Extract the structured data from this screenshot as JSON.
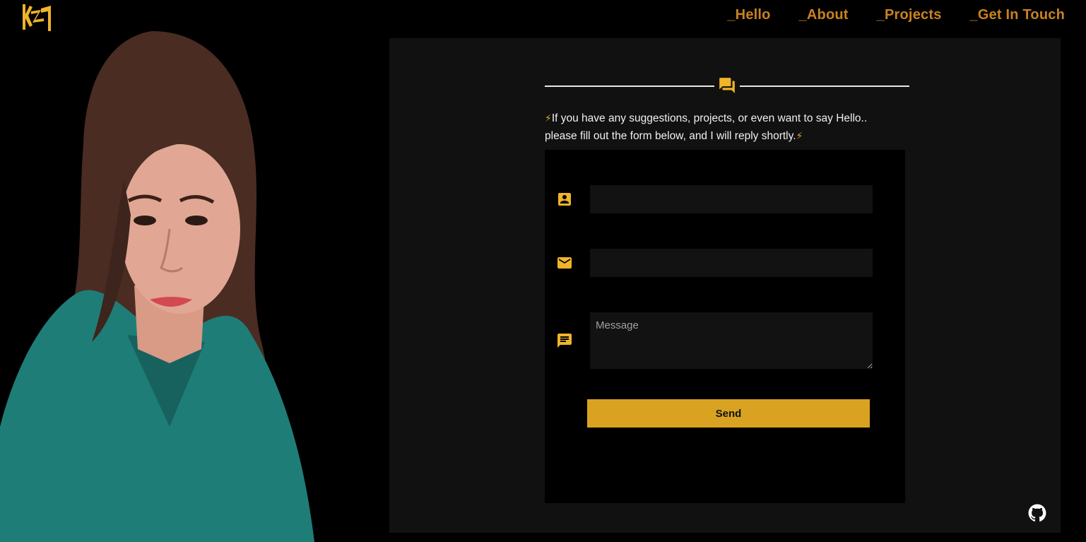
{
  "brand": {
    "logo_icon": "kz-logo-icon",
    "accent": "#f0b428"
  },
  "nav": {
    "items": [
      {
        "label": "_Hello"
      },
      {
        "label": "_About"
      },
      {
        "label": "_Projects"
      },
      {
        "label": "_Get In Touch"
      }
    ],
    "color": "#c9821f"
  },
  "contact": {
    "divider_icon": "chat-icon",
    "intro_line1": "If you have any suggestions, projects, or even want to say Hello..",
    "intro_line2": "please fill out the form below, and I will reply shortly.",
    "bolt": "⚡",
    "form": {
      "name": {
        "icon": "person-icon",
        "value": "",
        "placeholder": ""
      },
      "email": {
        "icon": "mail-icon",
        "value": "",
        "placeholder": ""
      },
      "message": {
        "icon": "message-icon",
        "value": "",
        "placeholder": "Message"
      },
      "send_label": "Send"
    }
  },
  "footer": {
    "github_icon": "github-icon"
  },
  "colors": {
    "panel": "#111111",
    "form_bg": "#000000",
    "button": "#d9a321"
  }
}
